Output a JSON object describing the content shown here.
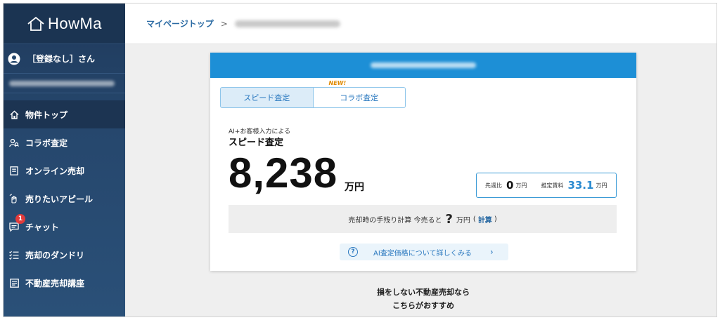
{
  "brand": {
    "name": "HowMa"
  },
  "user": {
    "name": "［登録なし］さん"
  },
  "sidebar": {
    "items": [
      {
        "label": "物件トップ",
        "icon": "home-icon"
      },
      {
        "label": "コラボ査定",
        "icon": "user-search-icon"
      },
      {
        "label": "オンライン売却",
        "icon": "document-icon"
      },
      {
        "label": "売りたいアピール",
        "icon": "hand-icon"
      },
      {
        "label": "チャット",
        "icon": "chat-icon",
        "badge": "1"
      },
      {
        "label": "売却のダンドリ",
        "icon": "checklist-icon"
      },
      {
        "label": "不動産売却講座",
        "icon": "book-icon"
      }
    ]
  },
  "breadcrumb": {
    "top": "マイページトップ",
    "separator": ">"
  },
  "tabs": {
    "speed": "スピード査定",
    "collab": "コラボ査定",
    "new_tag": "NEW!"
  },
  "estimate": {
    "subtitle": "AI+お客様入力による",
    "title": "スピード査定",
    "price": "8,238",
    "unit": "万円"
  },
  "stats": {
    "prev_label": "先週比",
    "prev_value": "0",
    "prev_unit": "万円",
    "rent_label": "推定賃料",
    "rent_value": "33.1",
    "rent_unit": "万円"
  },
  "calc": {
    "prefix": "売却時の手残り計算 今売ると",
    "mark": "?",
    "unit": "万円",
    "open": "(",
    "link": "計算",
    "close": ")"
  },
  "detail": {
    "label": "AI査定価格について詳しくみる",
    "icon": "?",
    "chevron": "›"
  },
  "promo": {
    "line1": "損をしない不動産売却なら",
    "line2": "こちらがおすすめ"
  },
  "colors": {
    "sidebar": "#24466b",
    "accent": "#1d8fd6",
    "link": "#2a6aa3"
  }
}
